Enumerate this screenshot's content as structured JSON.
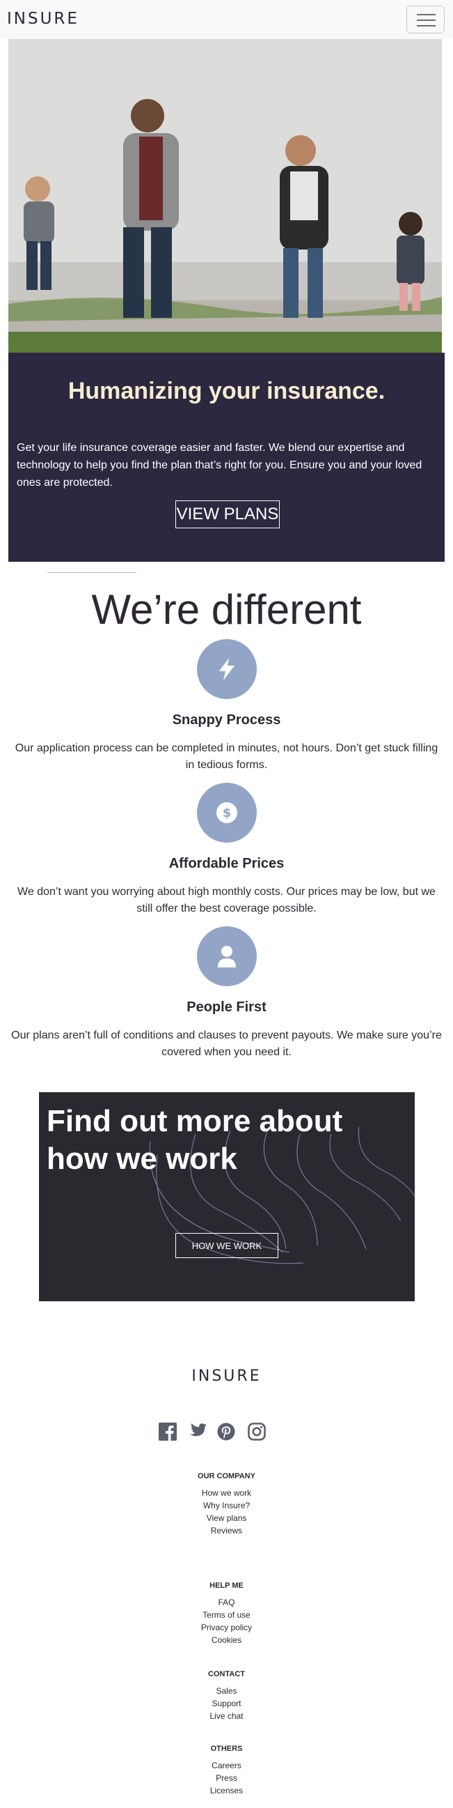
{
  "navbar": {
    "brand": "INSURE",
    "menu_icon": "hamburger-icon"
  },
  "hero": {
    "image_alt": "family-walking-photo",
    "title": "Humanizing your insurance.",
    "description": "Get your life insurance coverage easier and faster. We blend our expertise and technology to help you find the plan that’s right for you. Ensure you and your loved ones are protected.",
    "button": "VIEW PLANS",
    "panel_color": "#2c2840",
    "title_color": "#f6ecd1"
  },
  "different": {
    "heading": "We’re different",
    "features": [
      {
        "icon": "lightning-icon",
        "title": "Snappy Process",
        "description": "Our application process can be completed in minutes, not hours. Don’t get stuck filling in tedious forms."
      },
      {
        "icon": "dollar-icon",
        "title": "Affordable Prices",
        "description": "We don’t want you worrying about high monthly costs. Our prices may be low, but we still offer the best coverage possible."
      },
      {
        "icon": "person-icon",
        "title": "People First",
        "description": "Our plans aren’t full of conditions and clauses to prevent payouts. We make sure you’re covered when you need it."
      }
    ],
    "icon_bg": "#93a5c6"
  },
  "find_more": {
    "title": "Find out more about how we work",
    "button": "HOW WE WORK",
    "bg_color": "#2c2830"
  },
  "footer": {
    "brand": "INSURE",
    "socials": [
      "facebook-icon",
      "twitter-icon",
      "pinterest-icon",
      "instagram-icon"
    ],
    "columns": [
      {
        "heading": "OUR COMPANY",
        "links": [
          "How we work",
          "Why Insure?",
          "View plans",
          "Reviews"
        ]
      },
      {
        "heading": "HELP ME",
        "links": [
          "FAQ",
          "Terms of use",
          "Privacy policy",
          "Cookies"
        ]
      },
      {
        "heading": "CONTACT",
        "links": [
          "Sales",
          "Support",
          "Live chat"
        ]
      },
      {
        "heading": "OTHERS",
        "links": [
          "Careers",
          "Press",
          "Licenses"
        ]
      }
    ]
  }
}
